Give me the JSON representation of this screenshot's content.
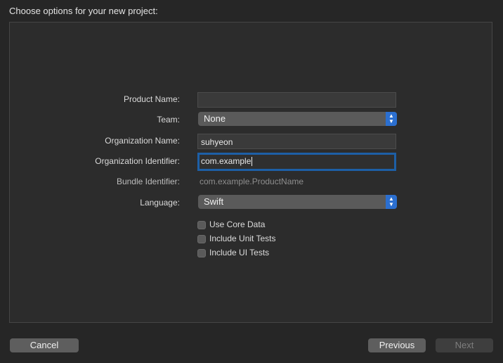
{
  "header": {
    "title": "Choose options for your new project:"
  },
  "form": {
    "product_name": {
      "label": "Product Name:",
      "value": ""
    },
    "team": {
      "label": "Team:",
      "value": "None"
    },
    "organization_name": {
      "label": "Organization Name:",
      "value": "suhyeon"
    },
    "organization_identifier": {
      "label": "Organization Identifier:",
      "value": "com.example"
    },
    "bundle_identifier": {
      "label": "Bundle Identifier:",
      "value": "com.example.ProductName"
    },
    "language": {
      "label": "Language:",
      "value": "Swift"
    },
    "checkboxes": {
      "core_data": {
        "label": "Use Core Data",
        "checked": false
      },
      "unit_tests": {
        "label": "Include Unit Tests",
        "checked": false
      },
      "ui_tests": {
        "label": "Include UI Tests",
        "checked": false
      }
    }
  },
  "footer": {
    "cancel_label": "Cancel",
    "previous_label": "Previous",
    "next_label": "Next"
  },
  "colors": {
    "accent": "#2b6fd0",
    "focus_ring": "#1d5fa6",
    "background": "#262626"
  }
}
